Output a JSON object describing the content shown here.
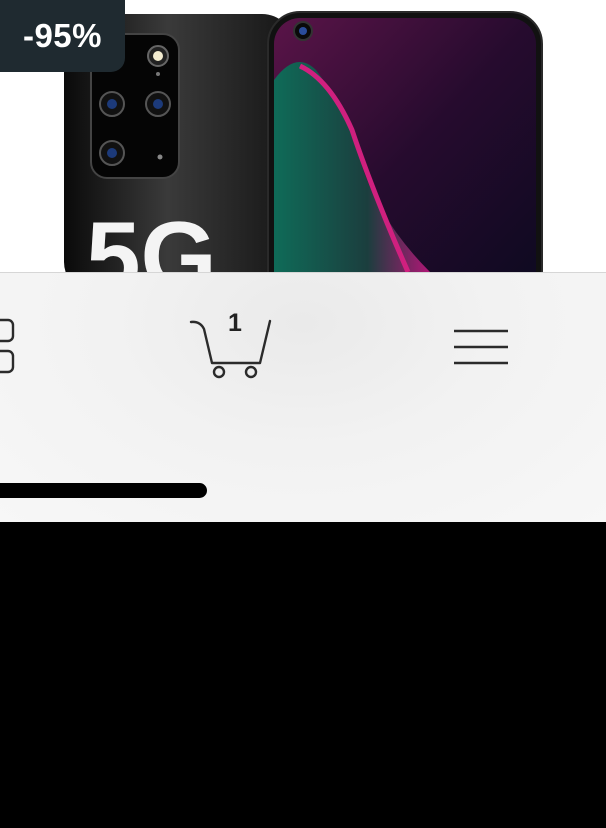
{
  "product": {
    "discount_label": "-95%",
    "image_icon": "smartphone-5g-image",
    "image_text": "5G"
  },
  "nav": {
    "grid_icon": "grid-icon",
    "cart_icon": "cart-icon",
    "cart_count": "1",
    "menu_icon": "hamburger-menu-icon"
  },
  "colors": {
    "badge_bg": "#1f2a30",
    "bar_bg": "#f2f2f2",
    "screen_bg": "#000000"
  }
}
